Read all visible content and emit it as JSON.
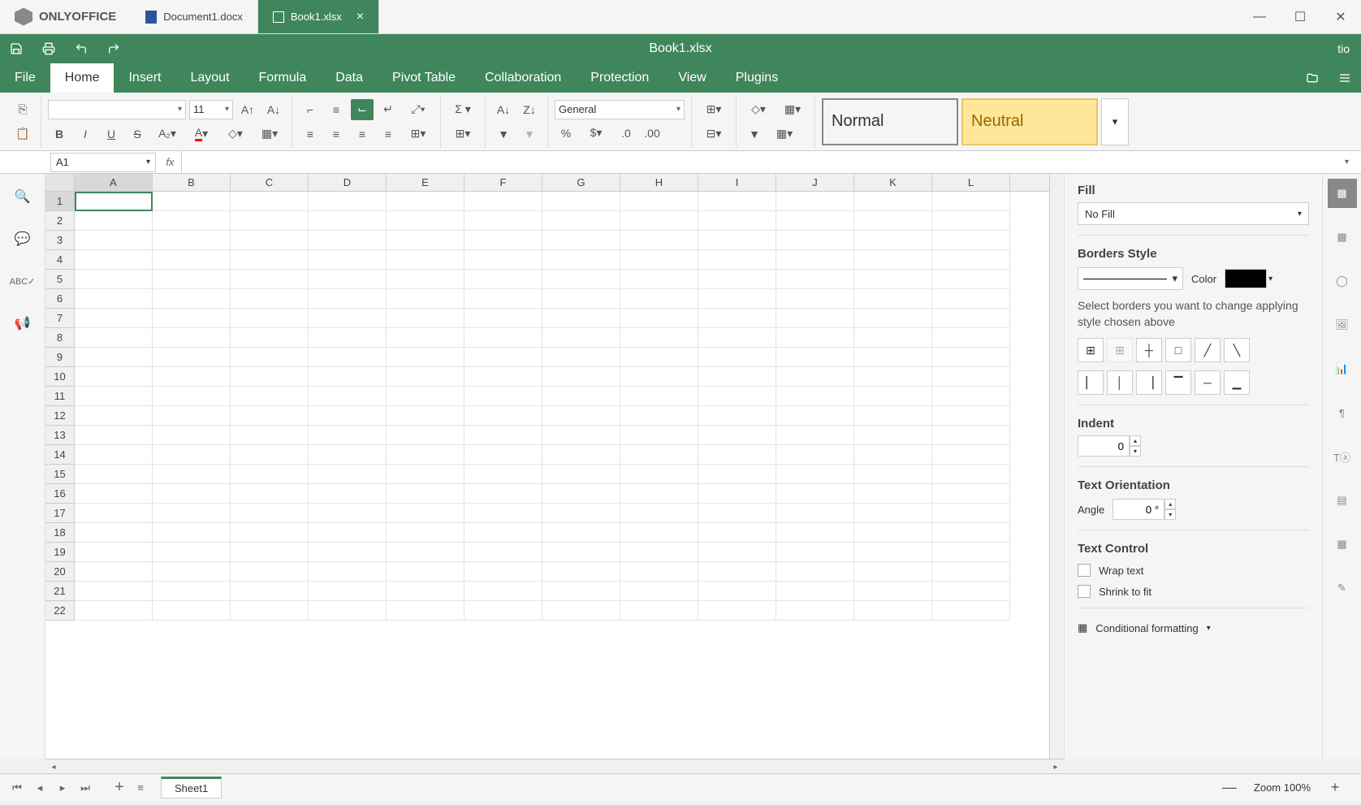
{
  "app_name": "ONLYOFFICE",
  "tabs": [
    {
      "label": "Document1.docx",
      "active": false
    },
    {
      "label": "Book1.xlsx",
      "active": true
    }
  ],
  "document_title": "Book1.xlsx",
  "user": "tio",
  "menu": {
    "items": [
      "File",
      "Home",
      "Insert",
      "Layout",
      "Formula",
      "Data",
      "Pivot Table",
      "Collaboration",
      "Protection",
      "View",
      "Plugins"
    ],
    "active": "Home"
  },
  "ribbon": {
    "font_name": "",
    "font_size": "11",
    "number_format": "General",
    "style_normal": "Normal",
    "style_neutral": "Neutral"
  },
  "namebox": "A1",
  "formula": "",
  "columns": [
    "A",
    "B",
    "C",
    "D",
    "E",
    "F",
    "G",
    "H",
    "I",
    "J",
    "K",
    "L"
  ],
  "rows": [
    1,
    2,
    3,
    4,
    5,
    6,
    7,
    8,
    9,
    10,
    11,
    12,
    13,
    14,
    15,
    16,
    17,
    18,
    19,
    20,
    21,
    22
  ],
  "active_cell": {
    "row": 1,
    "col": "A"
  },
  "right_panel": {
    "fill_label": "Fill",
    "fill_value": "No Fill",
    "borders_label": "Borders Style",
    "color_label": "Color",
    "borders_hint": "Select borders you want to change applying style chosen above",
    "indent_label": "Indent",
    "indent_value": "0",
    "orientation_label": "Text Orientation",
    "angle_label": "Angle",
    "angle_value": "0 °",
    "text_control_label": "Text Control",
    "wrap_label": "Wrap text",
    "shrink_label": "Shrink to fit",
    "cond_fmt_label": "Conditional formatting"
  },
  "sheet_tab": "Sheet1",
  "zoom_label": "Zoom 100%"
}
